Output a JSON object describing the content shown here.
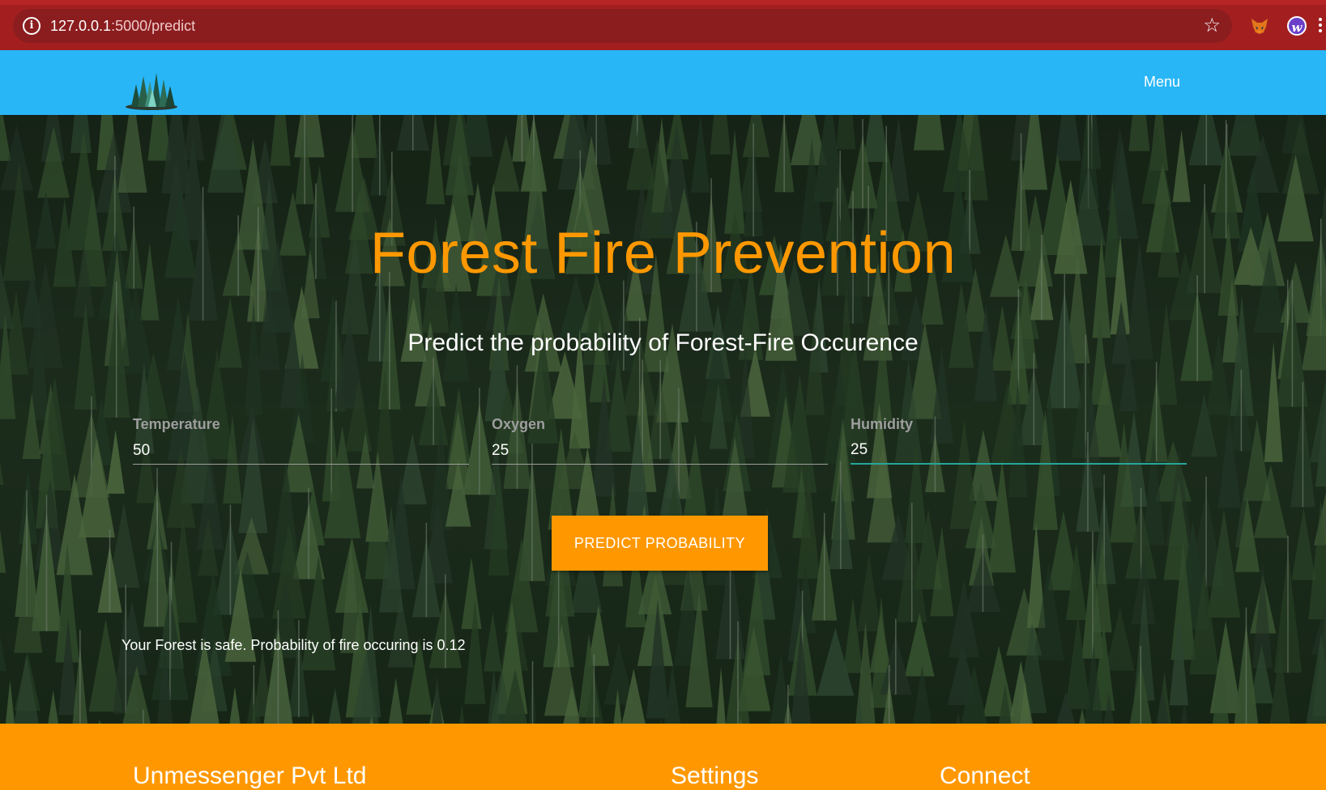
{
  "browser": {
    "url_host": "127.0.0.1",
    "url_path": ":5000/predict",
    "bookmark_icon": "star-icon",
    "site_info_icon": "info-icon",
    "site_info_glyph": "i",
    "extension_icons": [
      "fox-extension-icon",
      "w-extension-icon"
    ],
    "w_extension_glyph": "w",
    "theme_color": "#a31f1f"
  },
  "nav": {
    "menu_label": "Menu",
    "bg_color": "#29b6f6",
    "logo_icon": "forest-logo-icon"
  },
  "hero": {
    "title": "Forest Fire Prevention",
    "subtitle": "Predict the probability of Forest-Fire Occurence",
    "title_color": "#ff9800",
    "fields": {
      "temperature": {
        "label": "Temperature",
        "value": "50"
      },
      "oxygen": {
        "label": "Oxygen",
        "value": "25"
      },
      "humidity": {
        "label": "Humidity",
        "value": "25"
      }
    },
    "predict_button_label": "PREDICT PROBABILITY",
    "result": "Your Forest is safe. Probability of fire occuring is 0.12"
  },
  "footer": {
    "company": "Unmessenger Pvt Ltd",
    "settings": "Settings",
    "connect": "Connect",
    "bg_color": "#ff9800"
  }
}
